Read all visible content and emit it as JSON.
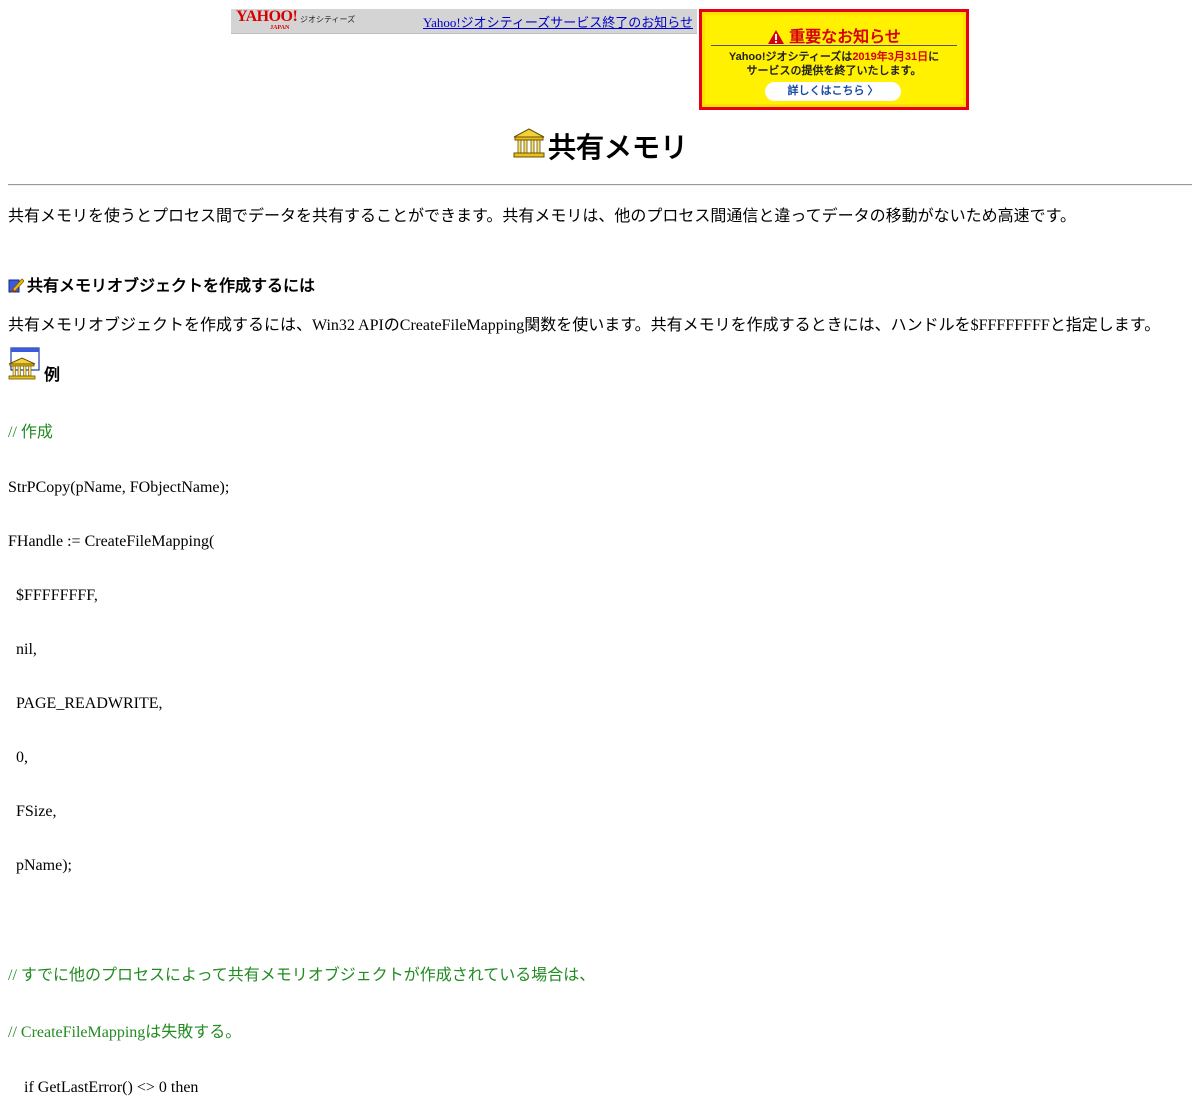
{
  "yahoo_bar": {
    "logo_text": "YAHOO!",
    "logo_sub": "JAPAN",
    "subtitle": "ジオシティーズ",
    "link_text": "Yahoo!ジオシティーズサービス終了のお知らせ"
  },
  "notice": {
    "title": "重要なお知らせ",
    "line1_a": "Yahoo!ジオシティーズは",
    "line1_date": "2019年3月31日",
    "line1_b": "に",
    "line2": "サービスの提供を終了いたします。",
    "button": "詳しくはこちら 〉",
    "colors": {
      "border": "#e60012",
      "background": "#fff100",
      "title": "#d7000f"
    }
  },
  "page": {
    "title": "共有メモリ",
    "intro": "共有メモリを使うとプロセス間でデータを共有することができます。共有メモリは、他のプロセス間通信と違ってデータの移動がないため高速です。",
    "section_title": "共有メモリオブジェクトを作成するには",
    "section_text": "共有メモリオブジェクトを作成するには、Win32 APIのCreateFileMapping関数を使います。共有メモリを作成するときには、ハンドルを$FFFFFFFFと指定します。",
    "example_label": "例"
  },
  "code": {
    "comment1": "// 作成",
    "lines1": [
      "StrPCopy(pName, FObjectName);",
      "FHandle := CreateFileMapping(",
      "  $FFFFFFFF,",
      "  nil,",
      "  PAGE_READWRITE,",
      "  0,",
      "  FSize,",
      "  pName);"
    ],
    "comment2": "// すでに他のプロセスによって共有メモリオブジェクトが作成されている場合は、",
    "comment3": "// CreateFileMappingは失敗する。",
    "lines2": [
      "    if GetLastError() <> 0 then"
    ],
    "comment_color": "#228b22"
  }
}
